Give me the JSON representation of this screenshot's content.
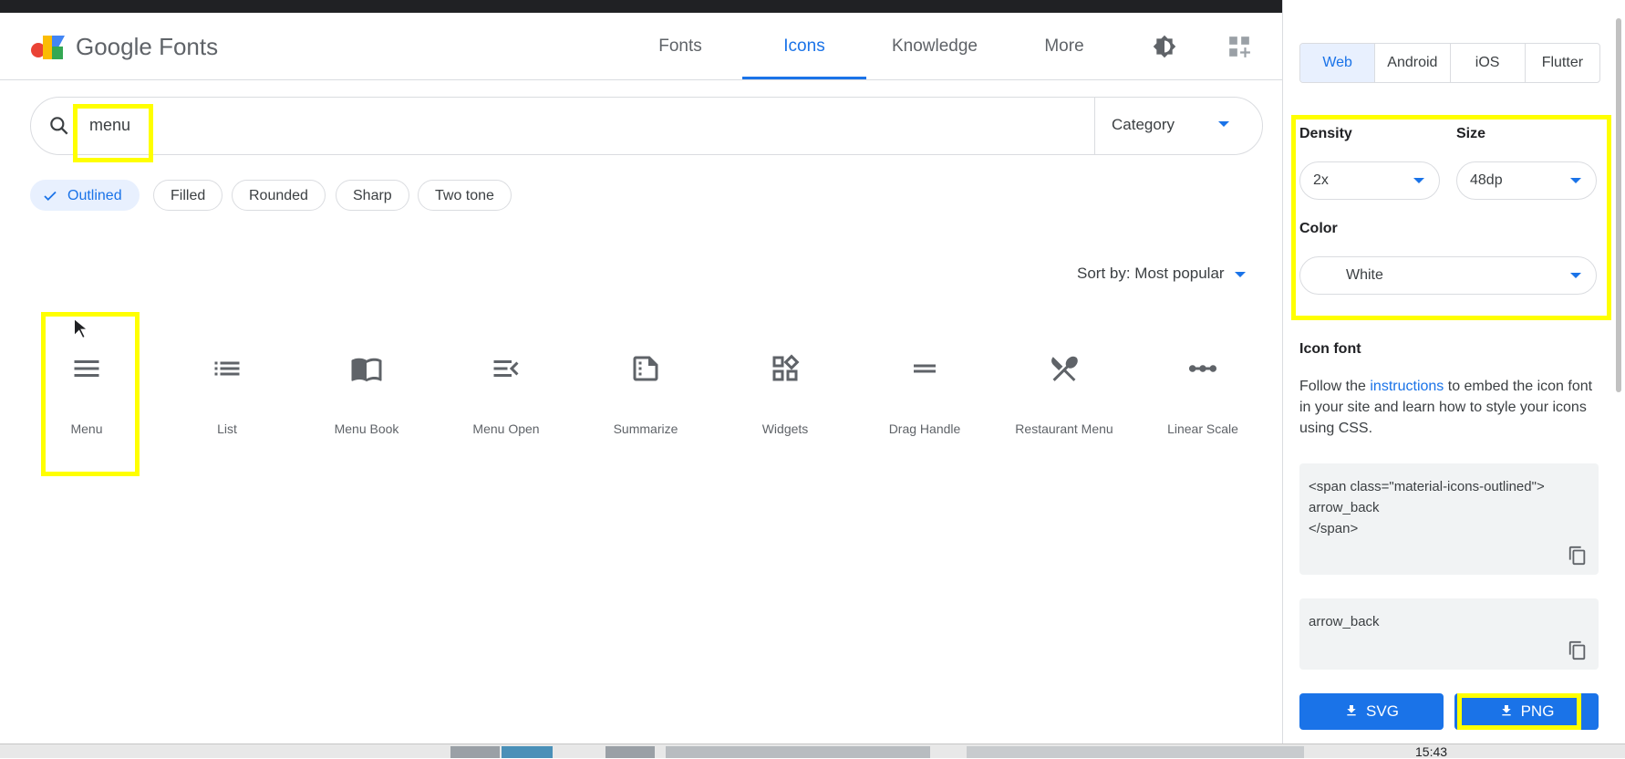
{
  "header": {
    "brand": "Google Fonts",
    "tabs": [
      {
        "label": "Fonts",
        "active": false
      },
      {
        "label": "Icons",
        "active": true
      },
      {
        "label": "Knowledge",
        "active": false
      },
      {
        "label": "More",
        "active": false
      }
    ],
    "icons": [
      "brightness-icon",
      "apps-add-icon"
    ]
  },
  "search": {
    "value": "menu",
    "category_label": "Category"
  },
  "style_chips": [
    {
      "label": "Outlined",
      "selected": true
    },
    {
      "label": "Filled",
      "selected": false
    },
    {
      "label": "Rounded",
      "selected": false
    },
    {
      "label": "Sharp",
      "selected": false
    },
    {
      "label": "Two tone",
      "selected": false
    }
  ],
  "sort": {
    "label": "Sort by: Most popular"
  },
  "icons": [
    {
      "name": "Menu",
      "icon": "menu-icon"
    },
    {
      "name": "List",
      "icon": "list-icon"
    },
    {
      "name": "Menu Book",
      "icon": "menu-book-icon"
    },
    {
      "name": "Menu Open",
      "icon": "menu-open-icon"
    },
    {
      "name": "Summarize",
      "icon": "summarize-icon"
    },
    {
      "name": "Widgets",
      "icon": "widgets-icon"
    },
    {
      "name": "Drag Handle",
      "icon": "drag-handle-icon"
    },
    {
      "name": "Restaurant Menu",
      "icon": "restaurant-menu-icon"
    },
    {
      "name": "Linear Scale",
      "icon": "linear-scale-icon"
    }
  ],
  "panel": {
    "platforms": [
      {
        "label": "Web",
        "active": true
      },
      {
        "label": "Android",
        "active": false
      },
      {
        "label": "iOS",
        "active": false
      },
      {
        "label": "Flutter",
        "active": false
      }
    ],
    "density_label": "Density",
    "density_value": "2x",
    "size_label": "Size",
    "size_value": "48dp",
    "color_label": "Color",
    "color_value": "White",
    "icon_font_title": "Icon font",
    "desc_before": "Follow the ",
    "desc_link": "instructions",
    "desc_after": " to embed the icon font in your site and learn how to style your icons using CSS.",
    "code_line1": "<span class=\"material-icons-outlined\">",
    "code_line2": "arrow_back",
    "code_line3": "</span>",
    "code2": "arrow_back",
    "svg_button": "SVG",
    "png_button": "PNG"
  },
  "taskbar": {
    "clock": "15:43"
  },
  "colors": {
    "accent": "#1a73e8",
    "highlight": "#ffff00"
  }
}
